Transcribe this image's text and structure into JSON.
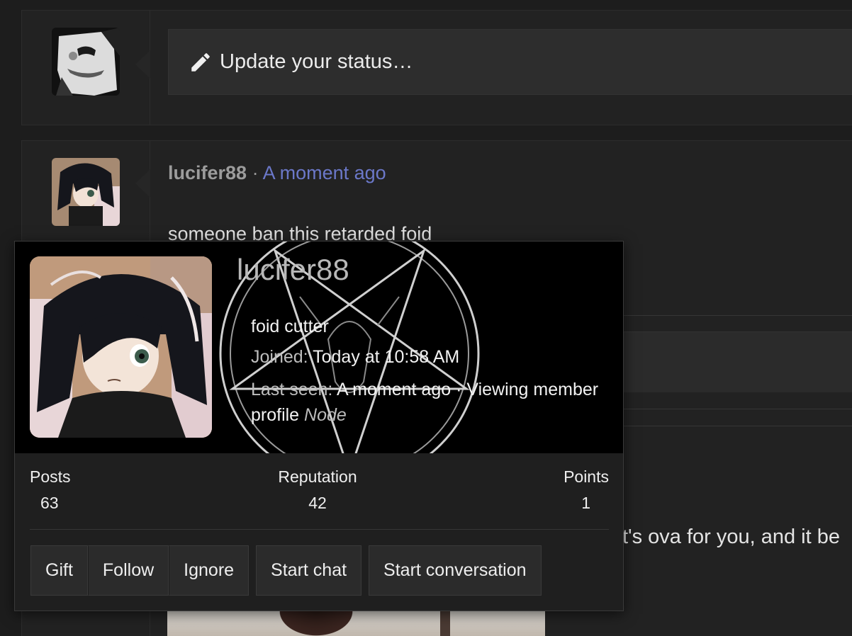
{
  "status_box": {
    "placeholder": "Update your status…",
    "icon": "pencil-icon"
  },
  "post": {
    "author": "lucifer88",
    "separator": "·",
    "time": "A moment ago",
    "text": "someone ban this retarded foid",
    "peek_text": "t's ova for you, and it be"
  },
  "member_card": {
    "username": "lucifer88",
    "user_title": "foid cutter",
    "joined_label": "Joined:",
    "joined_value": "Today at 10:58 AM",
    "last_seen_label": "Last seen:",
    "last_seen_value": "A moment ago · Viewing member profile",
    "last_seen_node": "Node",
    "stats": {
      "posts_label": "Posts",
      "posts_value": "63",
      "reputation_label": "Reputation",
      "reputation_value": "42",
      "points_label": "Points",
      "points_value": "1"
    },
    "actions": {
      "gift": "Gift",
      "follow": "Follow",
      "ignore": "Ignore",
      "start_chat": "Start chat",
      "start_conversation": "Start conversation"
    }
  },
  "colors": {
    "background": "#1d1d1d",
    "panel": "#222222",
    "link_time": "#6b78c9",
    "banner": "#000000"
  }
}
